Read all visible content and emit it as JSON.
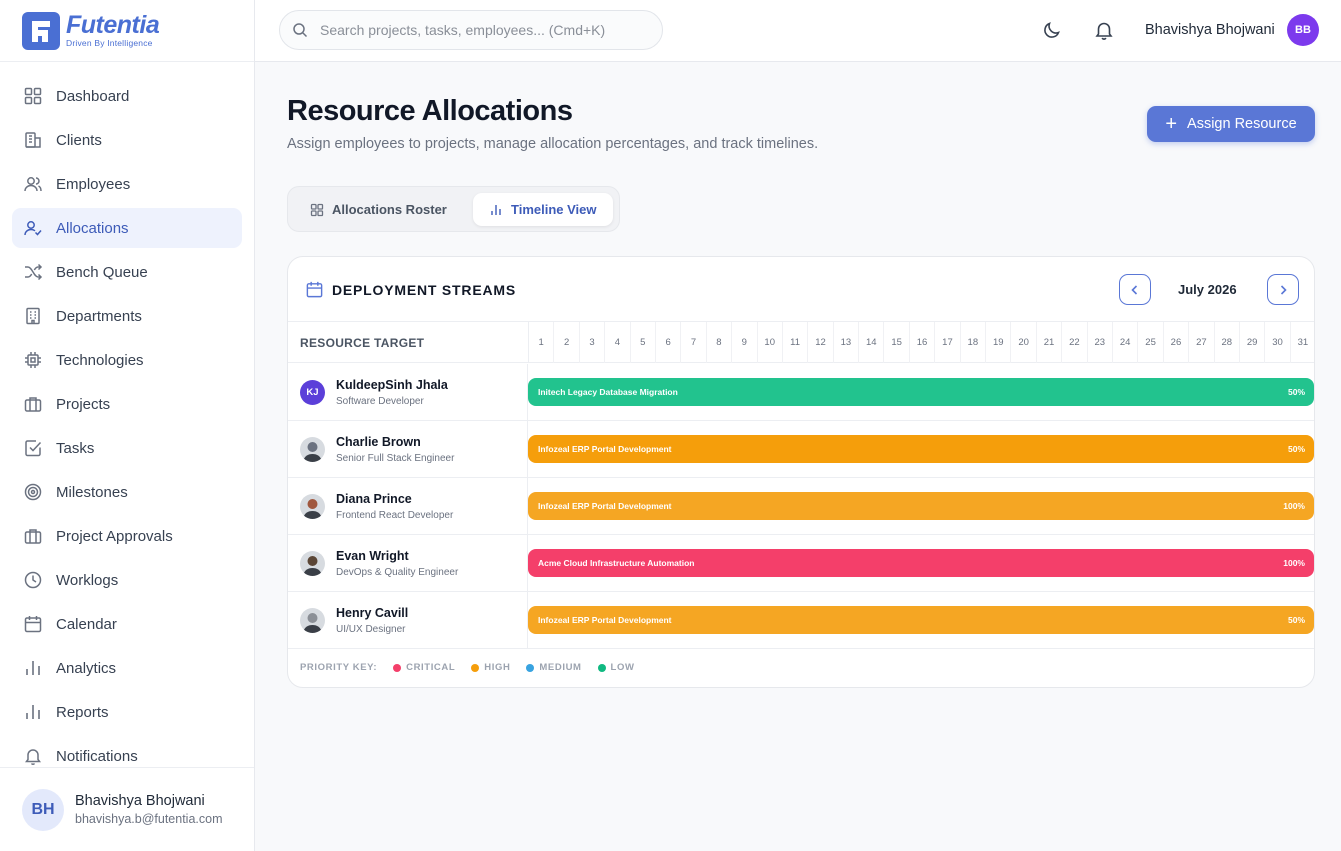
{
  "brand": {
    "name": "Futentia",
    "tagline": "Driven By Intelligence"
  },
  "sidebar": {
    "items": [
      {
        "label": "Dashboard",
        "icon": "dashboard-icon"
      },
      {
        "label": "Clients",
        "icon": "building-icon"
      },
      {
        "label": "Employees",
        "icon": "users-icon"
      },
      {
        "label": "Allocations",
        "icon": "user-check-icon",
        "active": true
      },
      {
        "label": "Bench Queue",
        "icon": "shuffle-icon"
      },
      {
        "label": "Departments",
        "icon": "office-icon"
      },
      {
        "label": "Technologies",
        "icon": "chip-icon"
      },
      {
        "label": "Projects",
        "icon": "briefcase-icon"
      },
      {
        "label": "Tasks",
        "icon": "checkbox-icon"
      },
      {
        "label": "Milestones",
        "icon": "target-icon"
      },
      {
        "label": "Project Approvals",
        "icon": "briefcase-icon"
      },
      {
        "label": "Worklogs",
        "icon": "clock-icon"
      },
      {
        "label": "Calendar",
        "icon": "calendar-icon"
      },
      {
        "label": "Analytics",
        "icon": "bar-chart-icon"
      },
      {
        "label": "Reports",
        "icon": "bar-chart-icon"
      },
      {
        "label": "Notifications",
        "icon": "bell-icon"
      }
    ],
    "footer": {
      "initials": "BH",
      "name": "Bhavishya Bhojwani",
      "email": "bhavishya.b@futentia.com"
    }
  },
  "topbar": {
    "search_placeholder": "Search projects, tasks, employees... (Cmd+K)",
    "user_name": "Bhavishya Bhojwani",
    "user_initials": "BB"
  },
  "main": {
    "title": "Resource Allocations",
    "subtitle": "Assign employees to projects, manage allocation percentages, and track timelines.",
    "assign_label": "Assign Resource",
    "tabs": [
      {
        "label": "Allocations Roster",
        "active": false
      },
      {
        "label": "Timeline View",
        "active": true
      }
    ]
  },
  "timeline": {
    "title": "DEPLOYMENT STREAMS",
    "month": "July 2026",
    "resource_header": "RESOURCE TARGET",
    "days": [
      "1",
      "2",
      "3",
      "4",
      "5",
      "6",
      "7",
      "8",
      "9",
      "10",
      "11",
      "12",
      "13",
      "14",
      "15",
      "16",
      "17",
      "18",
      "19",
      "20",
      "21",
      "22",
      "23",
      "24",
      "25",
      "26",
      "27",
      "28",
      "29",
      "30",
      "31"
    ],
    "rows": [
      {
        "name": "KuldeepSinh Jhala",
        "role": "Software Developer",
        "initials": "KJ",
        "project": "Initech Legacy Database Migration",
        "percent": "50%",
        "color": "#22c38e"
      },
      {
        "name": "Charlie Brown",
        "role": "Senior Full Stack Engineer",
        "initials": "",
        "project": "Infozeal ERP Portal Development",
        "percent": "50%",
        "color": "#f59e0b"
      },
      {
        "name": "Diana Prince",
        "role": "Frontend React Developer",
        "initials": "",
        "project": "Infozeal ERP Portal Development",
        "percent": "100%",
        "color": "#f5a623"
      },
      {
        "name": "Evan Wright",
        "role": "DevOps & Quality Engineer",
        "initials": "",
        "project": "Acme Cloud Infrastructure Automation",
        "percent": "100%",
        "color": "#f43f6a"
      },
      {
        "name": "Henry Cavill",
        "role": "UI/UX Designer",
        "initials": "",
        "project": "Infozeal ERP Portal Development",
        "percent": "50%",
        "color": "#f5a623"
      }
    ],
    "legend": {
      "key_label": "PRIORITY KEY:",
      "items": [
        {
          "label": "CRITICAL",
          "color": "#f43f6a"
        },
        {
          "label": "HIGH",
          "color": "#f59e0b"
        },
        {
          "label": "MEDIUM",
          "color": "#38a3e0"
        },
        {
          "label": "LOW",
          "color": "#10b981"
        }
      ]
    }
  },
  "colors": {
    "accent": "#5a77d6",
    "brand": "#4a6fd3",
    "active_bg": "#eef2fd"
  }
}
